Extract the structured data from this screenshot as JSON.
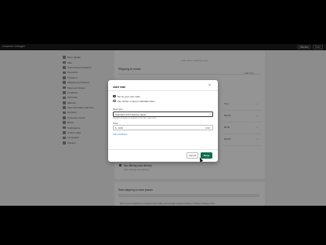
{
  "topbar": {
    "title": "Unsaved changes",
    "discard_label": "Discard",
    "save_label": "Save"
  },
  "sidebar": {
    "items": [
      {
        "label": "Store details",
        "icon": "store-icon"
      },
      {
        "label": "Plan",
        "icon": "plan-icon"
      },
      {
        "label": "Users and permissions",
        "icon": "users-icon"
      },
      {
        "label": "Payments",
        "icon": "payments-icon"
      },
      {
        "label": "Checkout",
        "icon": "checkout-icon"
      },
      {
        "label": "Shipping and delivery",
        "icon": "shipping-icon"
      },
      {
        "label": "Taxes and duties",
        "icon": "taxes-icon"
      },
      {
        "label": "Locations",
        "icon": "locations-icon"
      },
      {
        "label": "Gift cards",
        "icon": "gift-icon"
      },
      {
        "label": "Markets",
        "icon": "markets-icon"
      },
      {
        "label": "Apps and sales channels",
        "icon": "apps-icon"
      },
      {
        "label": "Domains",
        "icon": "domains-icon"
      },
      {
        "label": "Customer events",
        "icon": "events-icon"
      },
      {
        "label": "Brand",
        "icon": "brand-icon"
      },
      {
        "label": "Notifications",
        "icon": "notifications-icon"
      },
      {
        "label": "Custom data",
        "icon": "data-icon"
      },
      {
        "label": "Languages",
        "icon": "languages-icon"
      },
      {
        "label": "Policies",
        "icon": "policies-icon"
      }
    ]
  },
  "main": {
    "heading": "Shipping to zones",
    "top_link": "Learn about shipping zones",
    "add_zone": "Add zone",
    "rates": [
      "Free",
      "$10.00",
      "$5.00",
      "$15.00"
    ],
    "local_title": "Not offering local delivery",
    "local_sub": "Start offering local delivery",
    "bottom_title": "Start shipping to more places",
    "bottom_text": "Add countries/regions to a market to start selling and manage localized settings, including shipping zones."
  },
  "modal": {
    "title": "Add rate",
    "option_flat": "Set up your own rates",
    "option_calc": "Use carrier or app to calculate rates",
    "rate_type_label": "Rate type",
    "rate_type_value": "Standard (3-5 business days)",
    "rate_type_help": "Standard is shown by default if a free rate. Learn more",
    "price_label": "Price",
    "currency": "$",
    "price_value": "0.00",
    "price_unit": "USD",
    "add_conditions": "Add conditions",
    "cancel_label": "Cancel",
    "done_label": "Done"
  },
  "colors": {
    "primary": "#0d6e4f",
    "link": "#2c6ecb",
    "topbar": "#1a1a1a"
  }
}
